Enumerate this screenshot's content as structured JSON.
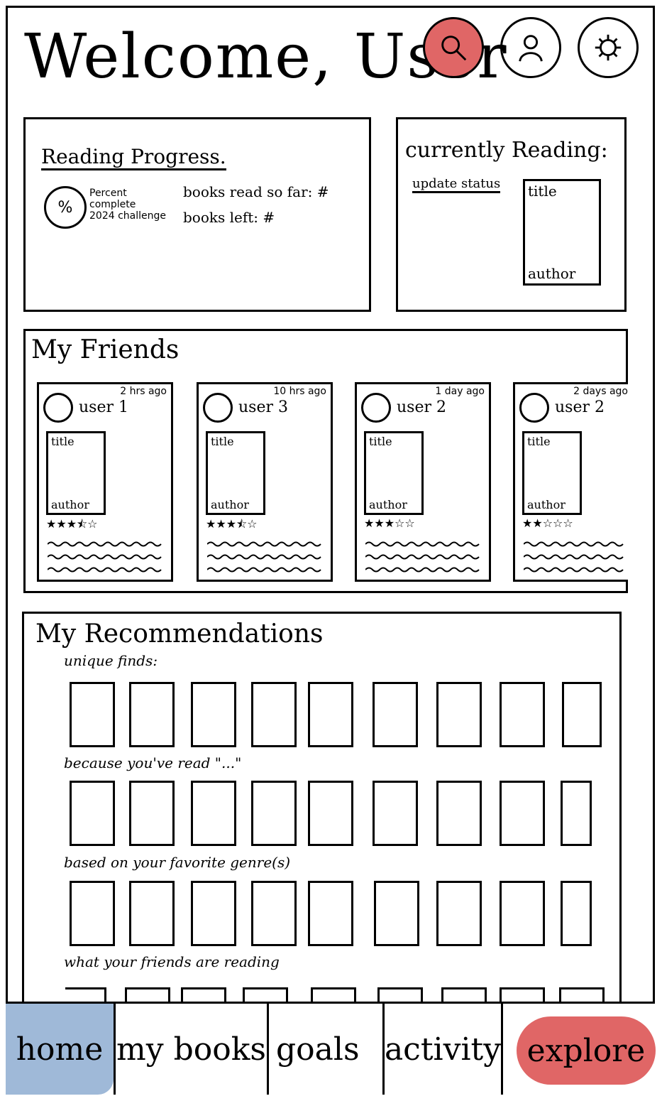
{
  "header": {
    "title": "Welcome, User",
    "search_icon": "search-icon",
    "profile_icon": "user-icon",
    "settings_icon": "gear-icon",
    "search_color": "#e06666"
  },
  "reading_progress": {
    "title": "Reading Progress.",
    "percent_symbol": "%",
    "percent_line1": "Percent",
    "percent_line2": "complete",
    "percent_line3": "2024 challenge",
    "books_read": "books read so far: #",
    "books_left": "books left: #"
  },
  "currently_reading": {
    "title": "currently Reading:",
    "update_status": "update status",
    "book_title": "title",
    "book_author": "author"
  },
  "friends": {
    "title": "My Friends",
    "cards": [
      {
        "user": "user 1",
        "ago": "2 hrs ago",
        "title": "title",
        "author": "author",
        "rating": 3.5,
        "stars": "★★★⯪☆"
      },
      {
        "user": "user 3",
        "ago": "10 hrs ago",
        "title": "title",
        "author": "author",
        "rating": 3.5,
        "stars": "★★★⯪☆"
      },
      {
        "user": "user 2",
        "ago": "1 day ago",
        "title": "title",
        "author": "author",
        "rating": 3,
        "stars": "★★★☆☆"
      },
      {
        "user": "user 2",
        "ago": "2 days ago",
        "title": "title",
        "author": "author",
        "rating": 2,
        "stars": "★★☆☆☆"
      }
    ]
  },
  "recommendations": {
    "title": "My Recommendations",
    "sections": [
      {
        "label": "unique finds:"
      },
      {
        "label": "because you've read \"...\""
      },
      {
        "label": "based on your favorite genre(s)"
      },
      {
        "label": "what your friends are reading"
      }
    ]
  },
  "nav": {
    "items": [
      {
        "label": "home",
        "color": "#9fb9d8"
      },
      {
        "label": "my books"
      },
      {
        "label": "goals"
      },
      {
        "label": "activity"
      },
      {
        "label": "explore",
        "color": "#e06666"
      }
    ]
  }
}
